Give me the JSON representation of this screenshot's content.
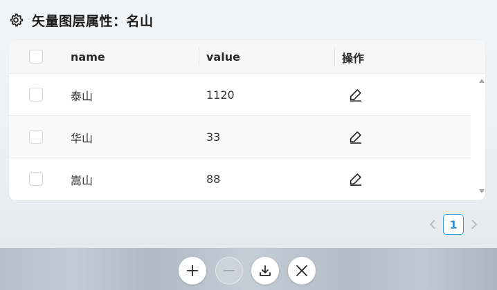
{
  "panel": {
    "title": "矢量图层属性：名山",
    "icon": "gear-icon"
  },
  "table": {
    "columns": {
      "name": "name",
      "value": "value",
      "actions": "操作"
    },
    "rows": [
      {
        "name": "泰山",
        "value": "1120",
        "action_icon": "edit-icon"
      },
      {
        "name": "华山",
        "value": "33",
        "action_icon": "edit-icon"
      },
      {
        "name": "嵩山",
        "value": "88",
        "action_icon": "edit-icon"
      }
    ]
  },
  "pagination": {
    "current_page": "1"
  },
  "toolbar": {
    "buttons": [
      {
        "icon": "plus-icon",
        "enabled": true
      },
      {
        "icon": "minus-icon",
        "enabled": false
      },
      {
        "icon": "download-icon",
        "enabled": true
      },
      {
        "icon": "close-icon",
        "enabled": true
      }
    ]
  },
  "colors": {
    "accent": "#2d8fd8",
    "toolbar_bg": "#b8c2cd"
  }
}
